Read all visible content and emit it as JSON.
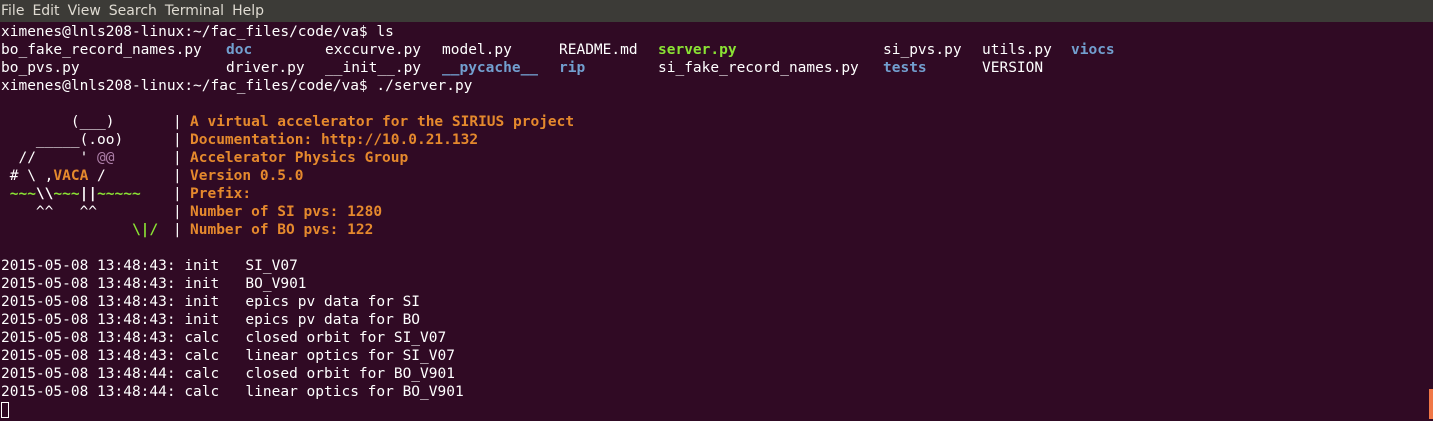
{
  "menu": [
    "File",
    "Edit",
    "View",
    "Search",
    "Terminal",
    "Help"
  ],
  "prompt1": "ximenes@lnls208-linux:~/fac_files/code/va$ ls",
  "ls_row1": [
    {
      "text": "bo_fake_record_names.py",
      "type": "file"
    },
    {
      "text": "doc",
      "type": "dir"
    },
    {
      "text": "exccurve.py",
      "type": "file"
    },
    {
      "text": "model.py",
      "type": "file"
    },
    {
      "text": "README.md",
      "type": "file"
    },
    {
      "text": "server.py",
      "type": "exe"
    },
    {
      "text": "si_pvs.py",
      "type": "file"
    },
    {
      "text": "utils.py",
      "type": "file"
    },
    {
      "text": "viocs",
      "type": "dir"
    }
  ],
  "ls_row2": [
    {
      "text": "bo_pvs.py",
      "type": "file"
    },
    {
      "text": "driver.py",
      "type": "file"
    },
    {
      "text": "__init__.py",
      "type": "file"
    },
    {
      "text": "__pycache__",
      "type": "dir"
    },
    {
      "text": "rip",
      "type": "dir"
    },
    {
      "text": "si_fake_record_names.py",
      "type": "file"
    },
    {
      "text": "tests",
      "type": "dir"
    },
    {
      "text": "VERSION",
      "type": "file"
    }
  ],
  "prompt2": "ximenes@lnls208-linux:~/fac_files/code/va$ ./server.py",
  "banner": {
    "art": [
      "        (___)",
      "    _____(.oo)",
      "  //     ' @@",
      " # \\ ,VACA /",
      " ~~~\\\\~~~||~~~~~",
      "    ^^   ^^",
      "               \\|/"
    ],
    "info": [
      "A virtual accelerator for the SIRIUS project",
      "Documentation: http://10.0.21.132",
      "Accelerator Physics Group",
      "Version 0.5.0",
      "Prefix:",
      "Number of SI pvs: 1280",
      "Number of BO pvs: 122"
    ],
    "separator": "|"
  },
  "log": [
    "2015-05-08 13:48:43: init   SI_V07",
    "2015-05-08 13:48:43: init   BO_V901",
    "2015-05-08 13:48:43: init   epics pv data for SI",
    "2015-05-08 13:48:43: init   epics pv data for BO",
    "2015-05-08 13:48:43: calc   closed orbit for SI_V07",
    "2015-05-08 13:48:43: calc   linear optics for SI_V07",
    "2015-05-08 13:48:44: calc   closed orbit for BO_V901",
    "2015-05-08 13:48:44: calc   linear optics for BO_V901"
  ],
  "colors": {
    "background": "#300a24",
    "directory": "#729fcf",
    "executable": "#8ae234",
    "banner_text": "#e5892d"
  }
}
